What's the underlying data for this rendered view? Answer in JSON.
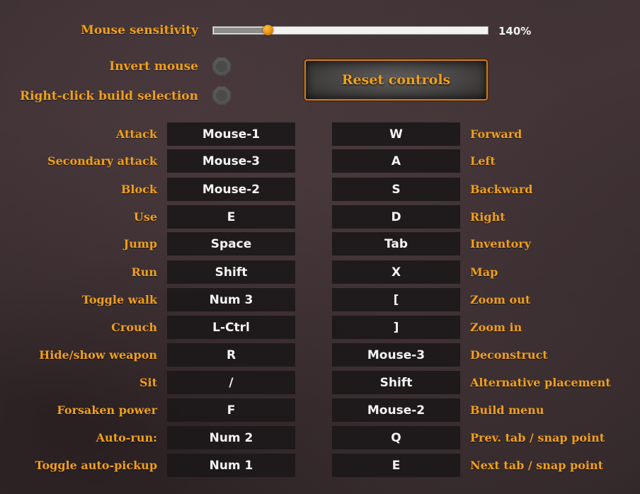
{
  "settings": {
    "mouse_sensitivity_label": "Mouse sensitivity",
    "mouse_sensitivity_value": "140%",
    "mouse_sensitivity_fraction": 0.2,
    "invert_mouse_label": "Invert mouse",
    "invert_mouse_on": false,
    "right_click_build_label": "Right-click build selection",
    "right_click_build_on": false,
    "reset_label": "Reset controls"
  },
  "colors": {
    "accent": "#f0a01c",
    "key_bg": "#1c1819",
    "background": "#3e3133"
  },
  "left_bindings": [
    {
      "action": "Attack",
      "key": "Mouse-1"
    },
    {
      "action": "Secondary attack",
      "key": "Mouse-3"
    },
    {
      "action": "Block",
      "key": "Mouse-2"
    },
    {
      "action": "Use",
      "key": "E"
    },
    {
      "action": "Jump",
      "key": "Space"
    },
    {
      "action": "Run",
      "key": "Shift"
    },
    {
      "action": "Toggle walk",
      "key": "Num 3"
    },
    {
      "action": "Crouch",
      "key": "L-Ctrl"
    },
    {
      "action": "Hide/show weapon",
      "key": "R"
    },
    {
      "action": "Sit",
      "key": "/"
    },
    {
      "action": "Forsaken power",
      "key": "F"
    },
    {
      "action": "Auto-run:",
      "key": "Num 2"
    },
    {
      "action": "Toggle auto-pickup",
      "key": "Num 1"
    }
  ],
  "right_bindings": [
    {
      "action": "Forward",
      "key": "W"
    },
    {
      "action": "Left",
      "key": "A"
    },
    {
      "action": "Backward",
      "key": "S"
    },
    {
      "action": "Right",
      "key": "D"
    },
    {
      "action": "Inventory",
      "key": "Tab"
    },
    {
      "action": "Map",
      "key": "X"
    },
    {
      "action": "Zoom out",
      "key": "["
    },
    {
      "action": "Zoom in",
      "key": "]"
    },
    {
      "action": "Deconstruct",
      "key": "Mouse-3"
    },
    {
      "action": "Alternative placement",
      "key": "Shift"
    },
    {
      "action": "Build menu",
      "key": "Mouse-2"
    },
    {
      "action": "Prev. tab / snap point",
      "key": "Q"
    },
    {
      "action": "Next tab / snap point",
      "key": "E"
    }
  ]
}
